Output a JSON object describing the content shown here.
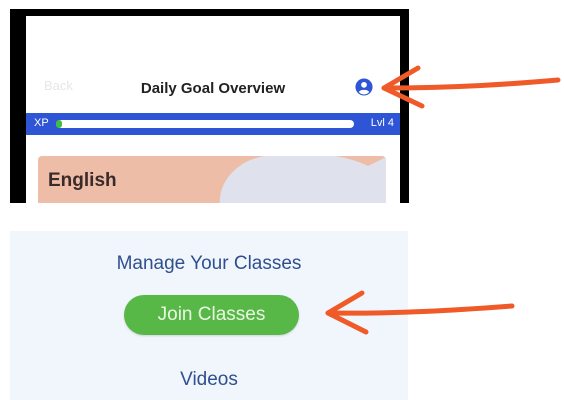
{
  "header": {
    "back_label": "Back",
    "title": "Daily Goal Overview",
    "profile_icon": "user-circle-icon"
  },
  "xp_bar": {
    "xp_label": "XP",
    "progress": 0.02,
    "level_label": "Lvl 4"
  },
  "subject_card": {
    "title": "English"
  },
  "classes": {
    "manage_label": "Manage Your Classes",
    "join_button_label": "Join Classes",
    "videos_label": "Videos"
  },
  "colors": {
    "accent_blue": "#2d55d6",
    "join_green": "#57b847",
    "arrow_orange": "#f05a28",
    "card_peach": "#eebda7"
  }
}
